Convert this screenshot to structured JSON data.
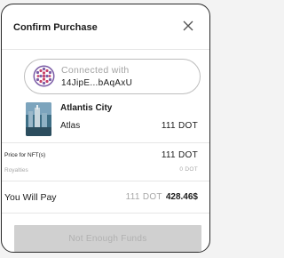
{
  "modal": {
    "title": "Confirm Purchase",
    "close_icon": "close-icon"
  },
  "wallet": {
    "connected_label": "Connected with",
    "address": "14JipE...bAqAxU",
    "avatar_icon": "wallet-identicon"
  },
  "nft": {
    "name": "Atlantis City",
    "collection": "Atlas",
    "price": "111 DOT"
  },
  "summary": {
    "price_label": "Price for NFT(s)",
    "price_value": "111 DOT",
    "royalties_label": "Royalties",
    "royalties_value": "0 DOT",
    "you_will_pay_label": "You Will Pay",
    "you_will_pay_dot": "111 DOT",
    "you_will_pay_usd": "428.46$"
  },
  "action": {
    "button_label": "Not Enough Funds",
    "disabled": true
  },
  "colors": {
    "border": "#2a2a2a",
    "identicon_primary": "#7b5ca6",
    "identicon_secondary": "#c7426a",
    "button_disabled_bg": "#d0d0d0",
    "muted_text": "#a8a8a8"
  }
}
